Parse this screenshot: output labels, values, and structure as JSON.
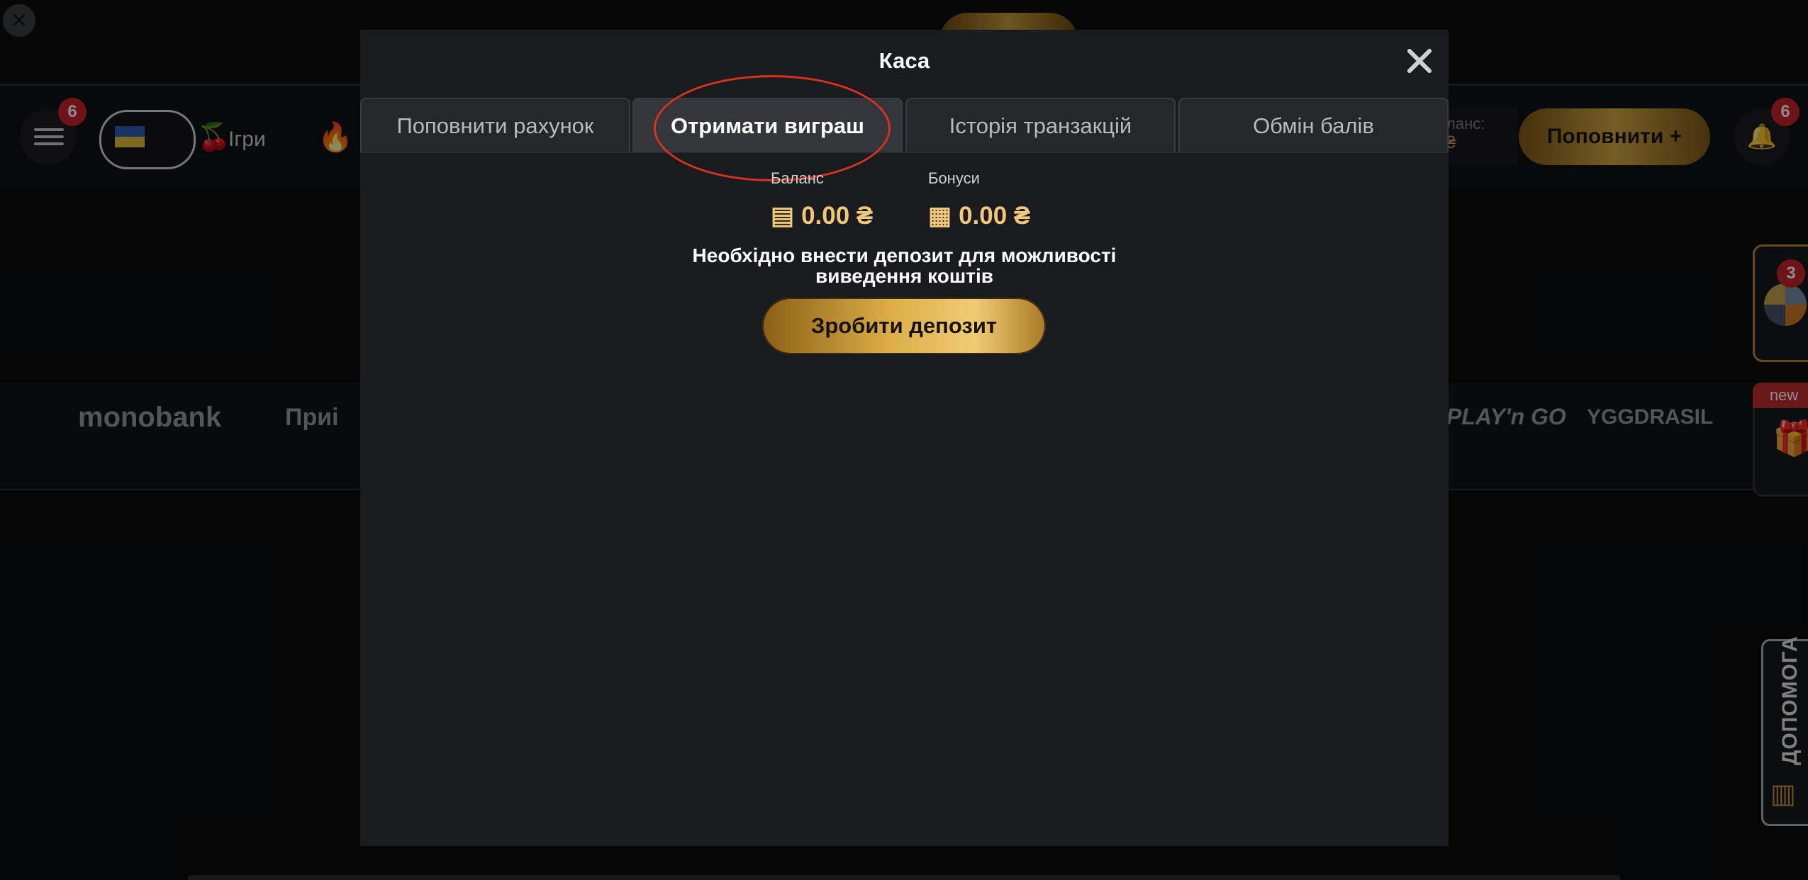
{
  "background": {
    "header": {
      "menu_badge": "6",
      "games_label": "Ігри",
      "balance_partial": "ланс:",
      "balance_currency_partial": "₴",
      "topup_button": "Поповнити +",
      "notifications_badge": "6"
    },
    "partners": [
      "monobank",
      "Приі",
      "PLAY'n GO",
      "YGGDRASIL"
    ],
    "side": {
      "wheel_badge": "3",
      "gift_tag": "new",
      "help_label": "ДОПОМОГА"
    }
  },
  "modal": {
    "title": "Каса",
    "tabs": [
      {
        "label": "Поповнити рахунок"
      },
      {
        "label": "Отримати виграш"
      },
      {
        "label": "Історія транзакцій"
      },
      {
        "label": "Обмін балів"
      }
    ],
    "active_tab_index": 1,
    "balance": {
      "label": "Баланс",
      "value": "0.00 ₴",
      "icon": "money-stack-icon"
    },
    "bonuses": {
      "label": "Бонуси",
      "value": "0.00 ₴",
      "icon": "gift-icon"
    },
    "message_line1": "Необхідно внести депозит для можливості",
    "message_line2": "виведення коштів",
    "deposit_button": "Зробити депозит"
  },
  "colors": {
    "accent_gold": "#dcae47",
    "badge_red": "#c8252c",
    "callout_red": "#d8321f"
  }
}
